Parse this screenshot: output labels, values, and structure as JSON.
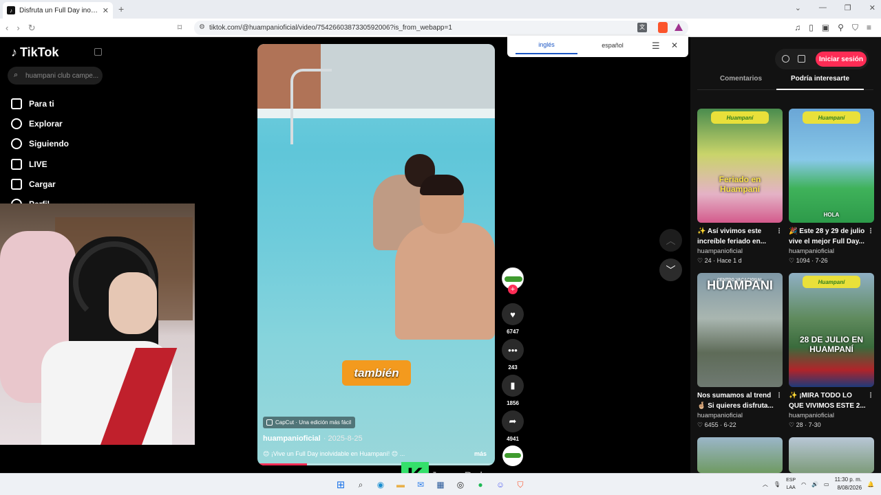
{
  "browser": {
    "tab_title": "Disfruta un Full Day inolvidable",
    "url": "tiktok.com/@huampanioficial/video/7542660387330592006?is_from_webapp=1"
  },
  "translate": {
    "lang1": "inglés",
    "lang2": "español"
  },
  "tiktok": {
    "brand": "TikTok",
    "search_placeholder": "huampani club campe...",
    "nav": [
      "Para ti",
      "Explorar",
      "Siguiendo",
      "LIVE",
      "Cargar",
      "Perfil"
    ]
  },
  "video": {
    "sticker_text": "también",
    "capcut_label": "CapCut · Una edición más fácil",
    "author": "huampanioficial",
    "date": "· 2025-8-25",
    "description": "😊 ¡Vive un Full Day inolvidable en Huampaní! 😊 ...",
    "more": "más",
    "progress": 0.21,
    "likes": "6747",
    "comments": "243",
    "saves": "1856",
    "shares": "4941"
  },
  "right_panel": {
    "login": "Iniciar sesión",
    "tab_comments": "Comentarios",
    "tab_suggest": "Podría interesarte",
    "cards": [
      {
        "banner": "Huampaní",
        "bigtext": "Feriado en Huampaní",
        "title": "✨ Así vivimos este increíble feriado en...",
        "author": "huampanioficial",
        "stats": "♡ 24 · Hace 1 d"
      },
      {
        "banner": "Huampaní",
        "bigtext": "HOLA",
        "title": "🎉 Este 28 y 29 de julio vive el mejor Full Day...",
        "author": "huampanioficial",
        "stats": "♡ 1094 · 7-26"
      },
      {
        "banner": "CENTRO VACACIONAL",
        "bigtext": "HUAMPANI",
        "title": "Nos sumamos al trend 🤞🏼 Si quieres disfruta...",
        "author": "huampanioficial",
        "stats": "♡ 6455 · 6-22"
      },
      {
        "banner": "Huampaní",
        "bigtext": "28 DE JULIO EN HUAMPANÍ",
        "title": "✨ ¡MIRA TODO LO QUE VIVIMOS ESTE 2...",
        "author": "huampanioficial",
        "stats": "♡ 28 · 7-30"
      }
    ]
  },
  "overlay": {
    "k": "K",
    "name": "JessyBaby"
  },
  "taskbar": {
    "lang_top": "ESP",
    "lang_bottom": "LAA",
    "time": "11:30 p. m.",
    "date": "8/08/2026"
  }
}
